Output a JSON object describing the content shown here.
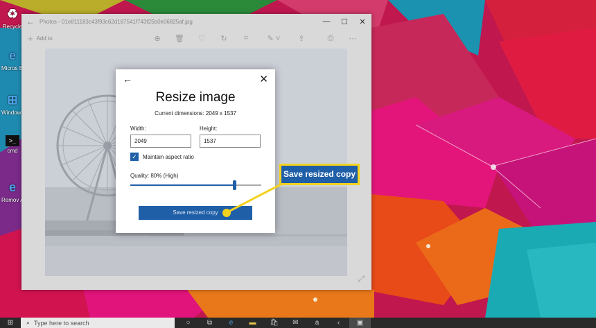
{
  "desktop": {
    "icons": [
      {
        "label": "Recycle",
        "icon": "recycle-bin-icon"
      },
      {
        "label": "Micros Edge",
        "icon": "edge-icon"
      },
      {
        "label": "Window Update",
        "icon": "windows-update-icon"
      },
      {
        "label": "cmd",
        "icon": "cmd-icon"
      },
      {
        "label": "Remov Apps",
        "icon": "edge-icon"
      }
    ]
  },
  "window": {
    "title": "Photos - 01e811183c43f93c62d187541f743f25b0e06825af.jpg",
    "add_to_label": "Add to",
    "toolbar_icons": [
      "zoom-icon",
      "delete-icon",
      "heart-icon",
      "rotate-icon",
      "crop-icon",
      "edit-icon",
      "share-icon",
      "print-icon",
      "more-icon"
    ]
  },
  "dialog": {
    "title": "Resize image",
    "current_dimensions": "Current dimensions: 2049 x 1537",
    "width_label": "Width:",
    "width_value": "2049",
    "height_label": "Height:",
    "height_value": "1537",
    "maintain_label": "Maintain aspect ratio",
    "maintain_checked": true,
    "quality_label": "Quality: 80% (High)",
    "quality_percent": 80,
    "save_label": "Save resized copy"
  },
  "callout": {
    "label": "Save resized copy",
    "color": "#f3d21f"
  },
  "taskbar": {
    "search_placeholder": "Type here to search",
    "apps": [
      "task-view-icon",
      "edge-icon",
      "file-explorer-icon",
      "store-icon",
      "mail-icon",
      "amazon-icon",
      "cmd-icon",
      "photos-icon"
    ]
  },
  "colors": {
    "accent": "#1f5fa8",
    "callout_border": "#f3d21f"
  }
}
